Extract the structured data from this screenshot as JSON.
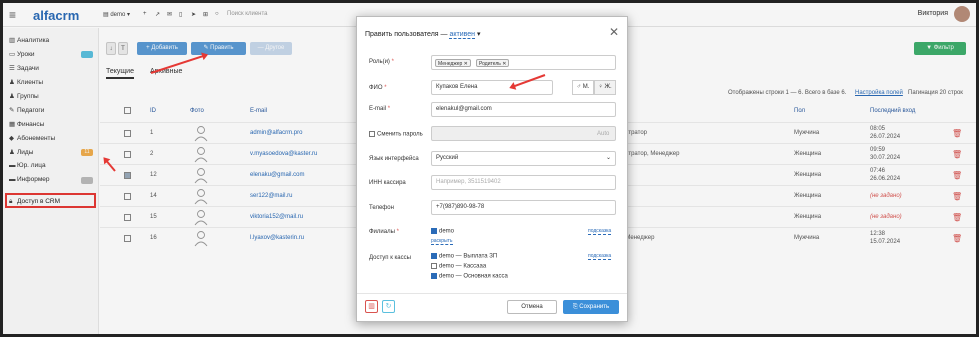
{
  "app": {
    "logo": "alfacrm"
  },
  "topbar": {
    "branch": "demo",
    "search_placeholder": "Поиск клиента",
    "user_name": "Виктория"
  },
  "sidebar": {
    "items": [
      {
        "label": "Аналитика",
        "icon": "chart-icon"
      },
      {
        "label": "Уроки",
        "icon": "calendar-icon",
        "badge": ""
      },
      {
        "label": "Задачи",
        "icon": "tasks-icon"
      },
      {
        "label": "Клиенты",
        "icon": "user-icon"
      },
      {
        "label": "Группы",
        "icon": "group-icon"
      },
      {
        "label": "Педагоги",
        "icon": "teacher-icon"
      },
      {
        "label": "Финансы",
        "icon": "finance-icon"
      },
      {
        "label": "Абонементы",
        "icon": "ticket-icon"
      },
      {
        "label": "Лиды",
        "icon": "leads-icon",
        "badge": "11"
      },
      {
        "label": "Юр. лица",
        "icon": "company-icon"
      },
      {
        "label": "Информер",
        "icon": "info-icon",
        "badge": ""
      },
      {
        "label": "Доступ в CRM",
        "icon": "lock-icon"
      }
    ],
    "badge_colors": [
      "#5bc0de",
      "#f0ad4e",
      "#bbbbbb"
    ]
  },
  "toolbar": {
    "add_label": "+ Добавить",
    "edit_label": "✎ Править",
    "more_label": "— Другое",
    "filter_label": "▼ Фильтр"
  },
  "tabs": [
    {
      "label": "Текущие"
    },
    {
      "label": "Архивные"
    }
  ],
  "table": {
    "summary": "Отображены строки 1 — 6. Всего в базе 6.",
    "settings_link": "Настройка полей",
    "pagination": "Пагинация 20 строк",
    "headers": {
      "id": "ID",
      "photo": "Фото",
      "email": "E-mail",
      "gender": "Пол",
      "last_login": "Последний вход"
    },
    "rows": [
      {
        "id": "1",
        "email": "admin@alfacrm.pro",
        "role": "истратор",
        "gender": "Мужчина",
        "login_date": "26.07.2024",
        "login_time": "08:05",
        "checked": false
      },
      {
        "id": "2",
        "email": "v.myasoedova@kaster.ru",
        "role": "истратор, Менеджер",
        "gender": "Женщина",
        "login_date": "30.07.2024",
        "login_time": "09:59",
        "checked": false
      },
      {
        "id": "12",
        "email": "elenaku@gmail.com",
        "role": "",
        "gender": "Женщина",
        "login_date": "26.06.2024",
        "login_time": "07:46",
        "checked": true
      },
      {
        "id": "14",
        "email": "ser122@mail.ru",
        "role": "",
        "gender": "Женщина",
        "login_date": "",
        "login_time": "(не задано)",
        "checked": false
      },
      {
        "id": "15",
        "email": "viktoria152@mail.ru",
        "role": "",
        "gender": "Женщина",
        "login_date": "",
        "login_time": "(не задано)",
        "checked": false
      },
      {
        "id": "16",
        "email": "l.lyaxov@kasterin.ru",
        "role": ", Менеджер",
        "gender": "Мужчина",
        "login_date": "15.07.2024",
        "login_time": "12:38",
        "checked": false
      }
    ]
  },
  "modal": {
    "title": "Править пользователя —",
    "status": "активен",
    "roles_label": "Роль(и)",
    "roles": [
      "Менеджер",
      "Родитель"
    ],
    "fio_label": "ФИО",
    "fio_value": "Купаков Елена",
    "gender_m": "♂ М.",
    "gender_f": "♀ Ж.",
    "email_label": "E-mail",
    "email_value": "elenakul@gmail.com",
    "password_label": "Сменить пароль",
    "password_btn": "Auto",
    "lang_label": "Язык интерфейса",
    "lang_value": "Русский",
    "inn_label": "ИНН кассира",
    "inn_placeholder": "Например, 3511519402",
    "phone_label": "Телефон",
    "phone_value": "+7(987)890-98-78",
    "branches_label": "Филиалы",
    "branch_demo": "demo",
    "branch_expand": "раскрыть",
    "hint": "подсказка",
    "cash_label": "Доступ к кассы",
    "cash_items": [
      {
        "label": "demo — Выплата ЗП",
        "checked": true
      },
      {
        "label": "demo — Кассааа",
        "checked": false
      },
      {
        "label": "demo — Основная касса",
        "checked": true
      }
    ],
    "cancel_label": "Отмена",
    "save_label": "⎘ Сохранить"
  }
}
